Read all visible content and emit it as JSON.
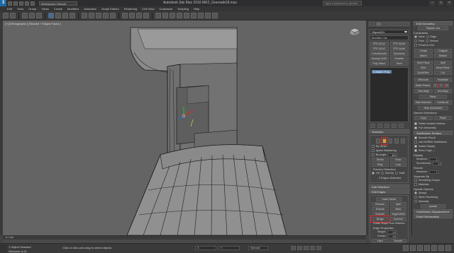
{
  "titlebar": {
    "logo": "3",
    "workspace": "Workspace: Default",
    "title": "Autodesk 3ds Max 2016     MK2_Grenade18.max",
    "search_placeholder": "Type a keyword or phrase"
  },
  "menu": [
    "Edit",
    "Tools",
    "Group",
    "Views",
    "Create",
    "Modifiers",
    "Animation",
    "Graph Editors",
    "Rendering",
    "Civil View",
    "Customize",
    "Scripting",
    "Help"
  ],
  "viewport": {
    "label": "[+] [Orthographic ] [Shaded + Edged Faces ]"
  },
  "command_panel": {
    "object_name": "Object001",
    "modifier_list": "Modifier List",
    "buttons": [
      "FFD 2x2x2",
      "FFD 3x3x3",
      "FFD 2x2x2",
      "FFD 4x4x4",
      "TurboSmooth",
      "Symmetry",
      "Unwrap UVW",
      "Chamfer",
      "Poly Select",
      "Shell"
    ],
    "stack_item": "Editable Poly",
    "selection": {
      "header": "Selection",
      "by_vertex": "By Vertex",
      "ignore_backfacing": "Ignore Backfacing",
      "by_angle": "By Angle:",
      "angle_value": "45.0",
      "shrink": "Shrink",
      "grow": "Grow",
      "ring": "Ring",
      "loop": "Loop",
      "preview_selection": "Preview Selection",
      "off": "Off",
      "subobj": "SubObj",
      "multi": "Multi",
      "status": "2 Edges Selected"
    },
    "soft_selection": "Soft Selection",
    "edit_edges": {
      "header": "Edit Edges",
      "insert_vertex": "Insert Vertex",
      "buttons": [
        "Remove",
        "Split",
        "Extrude",
        "Weld",
        "Chamfer",
        "Target Weld",
        "Bridge",
        "Connect"
      ],
      "create_shape": "Create Shape From Selection",
      "edge_properties": "Edge Properties",
      "weight_label": "Weight:",
      "weight_value": "1.0",
      "crease_label": "Crease:",
      "crease_value": "0.0",
      "hard": "Hard",
      "smooth": "Smooth",
      "display_hard": "Display Hard Edges"
    }
  },
  "right_panel": {
    "header": "Edit Geometry",
    "repeat_last": "Repeat Last",
    "constraints": "Constraints",
    "none": "None",
    "edge": "Edge",
    "face": "Face",
    "normal": "Normal",
    "preserve_uvs": "Preserve UVs",
    "create": "Create",
    "collapse": "Collapse",
    "attach": "Attach",
    "detach": "Detach",
    "slice_plane": "Slice Plane",
    "split": "Split",
    "slice": "Slice",
    "reset_plane": "Reset Plane",
    "quickslice": "QuickSlice",
    "cut": "Cut",
    "msmooth": "MSmooth",
    "tessellate": "Tessellate",
    "make_planar": "Make Planar",
    "x": "X",
    "y": "Y",
    "z": "Z",
    "view_align": "View Align",
    "grid_align": "Grid Align",
    "relax": "Relax",
    "hide_selected": "Hide Selected",
    "unhide_all": "Unhide All",
    "hide_unselected": "Hide Unselected",
    "named_selections": "Named Selections:",
    "copy": "Copy",
    "paste": "Paste",
    "delete_isolated": "Delete Isolated Vertices",
    "full_interactivity": "Full Interactivity",
    "subdivision_surface": "Subdivision Surface",
    "smooth_result": "Smooth Result",
    "use_nurms": "Use NURMS Subdivision",
    "isoline_display": "Isoline Display",
    "show_cage": "Show Cage......",
    "display": "Display",
    "iterations_label": "Iterations:",
    "iterations_value": "1",
    "smoothness_label": "Smoothness:",
    "smoothness_value": "1.0",
    "render": "Render",
    "separate_by": "Separate By",
    "smoothing_groups": "Smoothing Groups",
    "materials": "Materials",
    "update_options": "Update Options",
    "always": "Always",
    "when_rendering": "When Rendering",
    "manually": "Manually",
    "update": "Update",
    "subdivision_displacement": "Subdivision Displacement",
    "paint_deformation": "Paint Deformation"
  },
  "status": {
    "selected": "1 Object Selected",
    "hint": "Click or click-and-drag to select objects",
    "welcome": "Welcome to M",
    "x": "X:",
    "y": "Y:",
    "z": "Z:",
    "selected_dropdown": "Selected",
    "autokey": "Auto Key",
    "setkey": "Set Key",
    "frame_range": "0 / 100",
    "add_time_tag": "Add Time Tag"
  },
  "colors": {
    "accent": "#5a7fa8",
    "highlight": "#d8a428",
    "annotation": "#e0262a",
    "viewport_bg": "#646464",
    "display_hard_swatch": "#22c55e"
  }
}
